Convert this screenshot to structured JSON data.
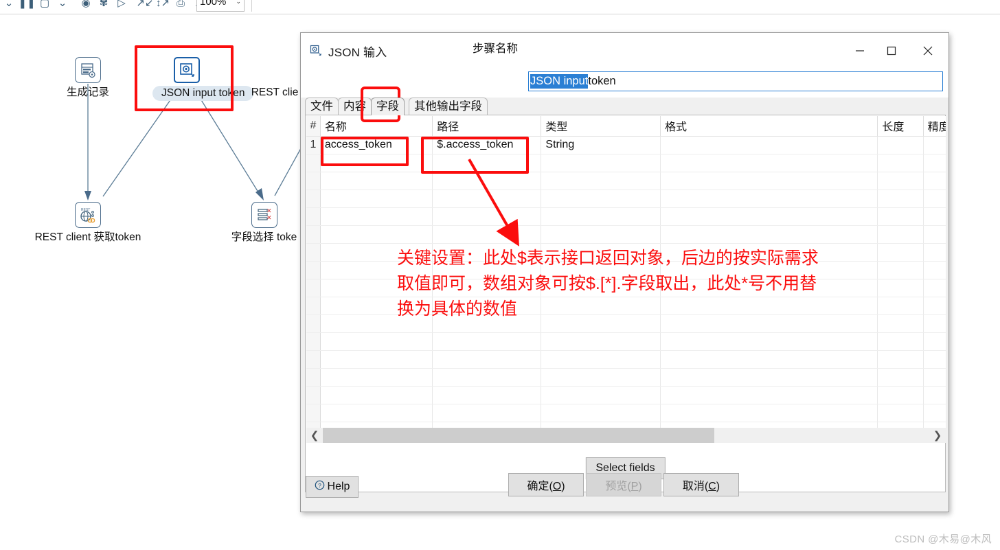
{
  "toolbar": {
    "zoom_level": "100%",
    "icons": [
      "undo-dropdown-icon",
      "pause-icon",
      "stop-icon",
      "stop-dropdown-icon",
      "preview-eye-icon",
      "debug-bug-icon",
      "run-play-icon",
      "align-left-icon",
      "distribute-icon",
      "snapshot-icon",
      "zoom-find-icon",
      "resize-icon"
    ]
  },
  "canvas": {
    "nodes": [
      {
        "id": "generate-rows",
        "label": "生成记录",
        "icon": "generate-rows-icon",
        "selected": false
      },
      {
        "id": "json-input-token",
        "label": "JSON input token",
        "icon": "json-input-icon",
        "selected": true
      },
      {
        "id": "rest-client",
        "label": "REST clie",
        "icon": "rest-client-icon",
        "selected": false
      },
      {
        "id": "rest-client-get-token",
        "label": "REST client 获取token",
        "icon": "rest-client-icon",
        "selected": false
      },
      {
        "id": "select-values-token",
        "label": "字段选择 toke",
        "icon": "select-values-icon",
        "selected": false
      }
    ]
  },
  "dialog": {
    "title": "JSON 输入",
    "title_icon": "json-input-icon",
    "window_buttons": {
      "minimize": "—",
      "maximize": "▢",
      "close": "✕"
    },
    "step_name_label": "步骤名称",
    "step_name_value_selected": "JSON input",
    "step_name_value_rest": " token",
    "tabs": [
      {
        "id": "file",
        "label": "文件",
        "active": false
      },
      {
        "id": "content",
        "label": "内容",
        "active": false
      },
      {
        "id": "fields",
        "label": "字段",
        "active": true
      },
      {
        "id": "extra-output",
        "label": "其他输出字段",
        "active": false
      }
    ],
    "table": {
      "headers": [
        "#",
        "名称",
        "路径",
        "类型",
        "格式",
        "长度",
        "精度"
      ],
      "rows": [
        {
          "num": "1",
          "name": "access_token",
          "path": "$.access_token",
          "type": "String",
          "format": "",
          "length": "",
          "precision": ""
        }
      ],
      "empty_row_count": 15
    },
    "scrollbar": {
      "left_arrow": "❮",
      "right_arrow": "❯"
    },
    "select_fields_label": "Select fields",
    "buttons": {
      "help": "Help",
      "help_icon": "question-circle-icon",
      "ok": "确定(O)",
      "ok_mnemonic": "O",
      "preview": "预览(P)",
      "preview_mnemonic": "P",
      "preview_disabled": true,
      "cancel": "取消(C)",
      "cancel_mnemonic": "C"
    }
  },
  "annotations": {
    "note_text": "关键设置：此处$表示接口返回对象，后边的按实际需求\n取值即可，数组对象可按$.[*].字段取出，此处*号不用替\n换为具体的数值",
    "highlight_color": "#fb0d0d",
    "boxes": [
      "node-json-input-box",
      "tab-fields-box",
      "cell-name-box",
      "cell-path-box"
    ]
  },
  "watermark": {
    "text": "CSDN @木易@木风"
  }
}
